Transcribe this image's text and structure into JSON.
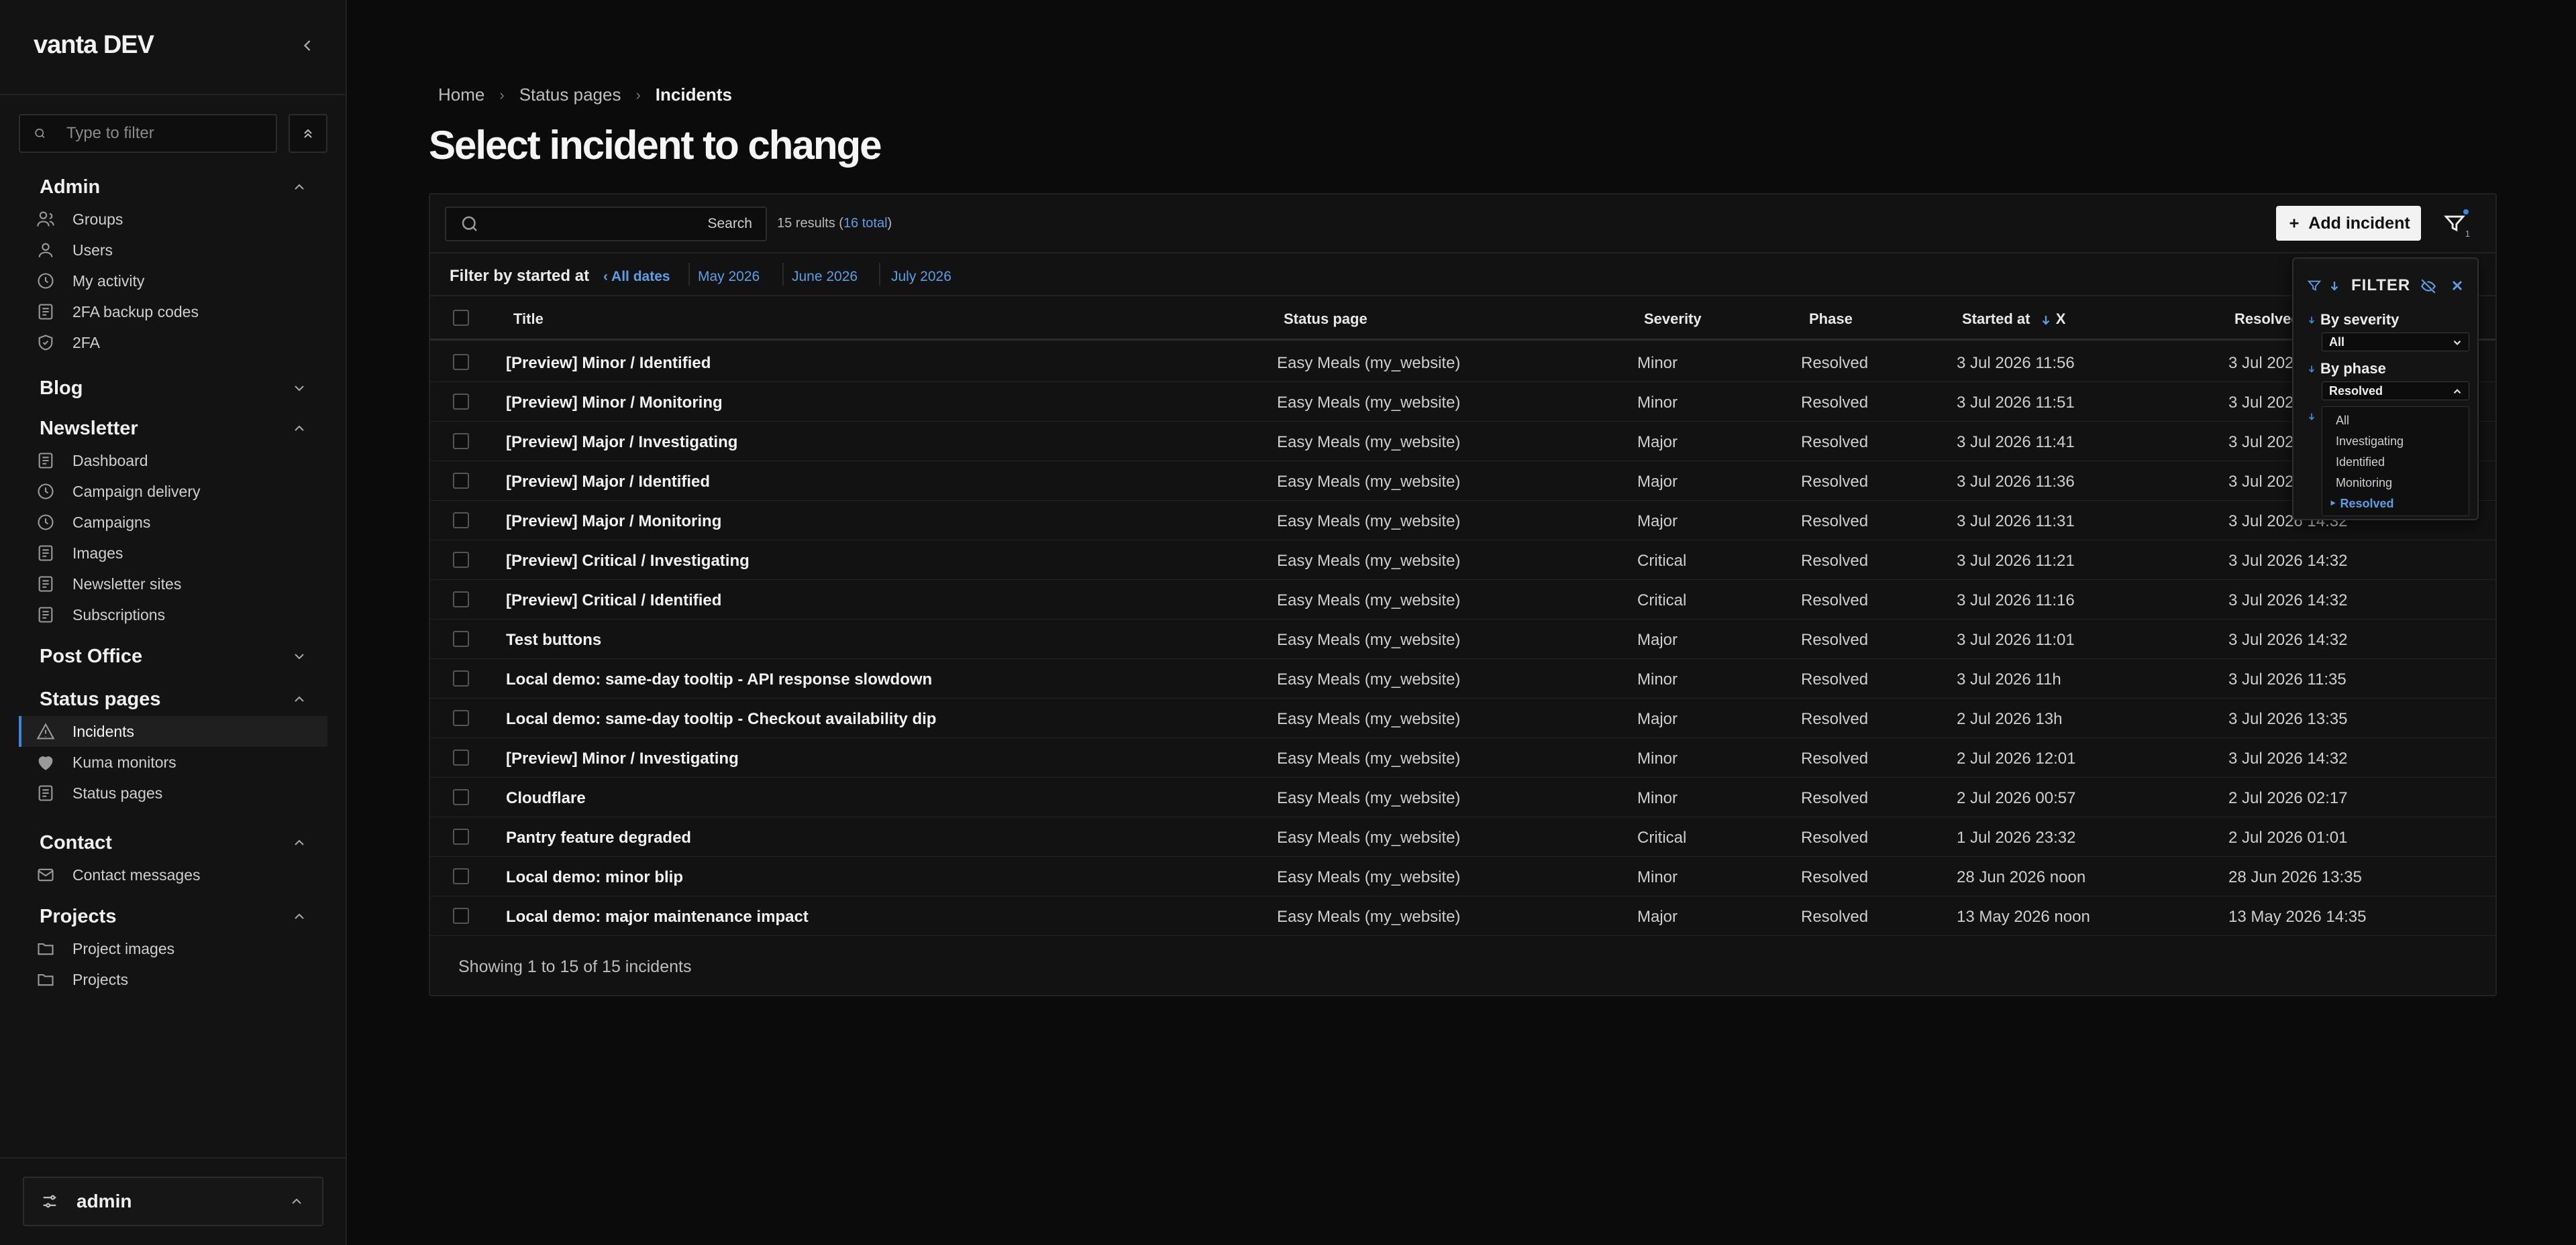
{
  "sidebar": {
    "brand": "vanta DEV",
    "filter_placeholder": "Type to filter",
    "groups": [
      {
        "title": "Admin",
        "items": [
          "Groups",
          "Users",
          "My activity",
          "2FA backup codes",
          "2FA"
        ]
      },
      {
        "title": "Blog",
        "items": []
      },
      {
        "title": "Newsletter",
        "items": [
          "Dashboard",
          "Campaign delivery",
          "Campaigns",
          "Images",
          "Newsletter sites",
          "Subscriptions"
        ]
      },
      {
        "title": "Post Office",
        "items": []
      },
      {
        "title": "Status pages",
        "items": [
          "Incidents",
          "Kuma monitors",
          "Status pages"
        ]
      },
      {
        "title": "Contact",
        "items": [
          "Contact messages"
        ]
      },
      {
        "title": "Projects",
        "items": [
          "Project images",
          "Projects"
        ]
      }
    ],
    "user": "admin"
  },
  "breadcrumb": {
    "home": "Home",
    "section": "Status pages",
    "current": "Incidents"
  },
  "page_title": "Select incident to change",
  "toolbar": {
    "search_button": "Search",
    "results_prefix": "15 results (",
    "results_total": "16 total",
    "results_suffix": ")",
    "add_button": "Add incident",
    "filter_count": "1"
  },
  "date_filter": {
    "label": "Filter by started at",
    "all": "‹ All dates",
    "links": [
      "May 2026",
      "June 2026",
      "July 2026"
    ]
  },
  "table": {
    "columns": {
      "title": "Title",
      "status_page": "Status page",
      "severity": "Severity",
      "phase": "Phase",
      "started_at": "Started at",
      "started_sort_clear": "X",
      "resolved_at": "Resolved at"
    },
    "rows": [
      {
        "title": "[Preview] Minor / Identified",
        "status_page": "Easy Meals (my_website)",
        "severity": "Minor",
        "phase": "Resolved",
        "started": "3 Jul 2026 11:56",
        "resolved": "3 Jul 2026 14:32"
      },
      {
        "title": "[Preview] Minor / Monitoring",
        "status_page": "Easy Meals (my_website)",
        "severity": "Minor",
        "phase": "Resolved",
        "started": "3 Jul 2026 11:51",
        "resolved": "3 Jul 2026 14:32"
      },
      {
        "title": "[Preview] Major / Investigating",
        "status_page": "Easy Meals (my_website)",
        "severity": "Major",
        "phase": "Resolved",
        "started": "3 Jul 2026 11:41",
        "resolved": "3 Jul 2026 14:32"
      },
      {
        "title": "[Preview] Major / Identified",
        "status_page": "Easy Meals (my_website)",
        "severity": "Major",
        "phase": "Resolved",
        "started": "3 Jul 2026 11:36",
        "resolved": "3 Jul 2026 14:32"
      },
      {
        "title": "[Preview] Major / Monitoring",
        "status_page": "Easy Meals (my_website)",
        "severity": "Major",
        "phase": "Resolved",
        "started": "3 Jul 2026 11:31",
        "resolved": "3 Jul 2026 14:32"
      },
      {
        "title": "[Preview] Critical / Investigating",
        "status_page": "Easy Meals (my_website)",
        "severity": "Critical",
        "phase": "Resolved",
        "started": "3 Jul 2026 11:21",
        "resolved": "3 Jul 2026 14:32"
      },
      {
        "title": "[Preview] Critical / Identified",
        "status_page": "Easy Meals (my_website)",
        "severity": "Critical",
        "phase": "Resolved",
        "started": "3 Jul 2026 11:16",
        "resolved": "3 Jul 2026 14:32"
      },
      {
        "title": "Test buttons",
        "status_page": "Easy Meals (my_website)",
        "severity": "Major",
        "phase": "Resolved",
        "started": "3 Jul 2026 11:01",
        "resolved": "3 Jul 2026 14:32"
      },
      {
        "title": "Local demo: same-day tooltip - API response slowdown",
        "status_page": "Easy Meals (my_website)",
        "severity": "Minor",
        "phase": "Resolved",
        "started": "3 Jul 2026 11h",
        "resolved": "3 Jul 2026 11:35"
      },
      {
        "title": "Local demo: same-day tooltip - Checkout availability dip",
        "status_page": "Easy Meals (my_website)",
        "severity": "Major",
        "phase": "Resolved",
        "started": "2 Jul 2026 13h",
        "resolved": "3 Jul 2026 13:35"
      },
      {
        "title": "[Preview] Minor / Investigating",
        "status_page": "Easy Meals (my_website)",
        "severity": "Minor",
        "phase": "Resolved",
        "started": "2 Jul 2026 12:01",
        "resolved": "3 Jul 2026 14:32"
      },
      {
        "title": "Cloudflare",
        "status_page": "Easy Meals (my_website)",
        "severity": "Minor",
        "phase": "Resolved",
        "started": "2 Jul 2026 00:57",
        "resolved": "2 Jul 2026 02:17"
      },
      {
        "title": "Pantry feature degraded",
        "status_page": "Easy Meals (my_website)",
        "severity": "Critical",
        "phase": "Resolved",
        "started": "1 Jul 2026 23:32",
        "resolved": "2 Jul 2026 01:01"
      },
      {
        "title": "Local demo: minor blip",
        "status_page": "Easy Meals (my_website)",
        "severity": "Minor",
        "phase": "Resolved",
        "started": "28 Jun 2026 noon",
        "resolved": "28 Jun 2026 13:35"
      },
      {
        "title": "Local demo: major maintenance impact",
        "status_page": "Easy Meals (my_website)",
        "severity": "Major",
        "phase": "Resolved",
        "started": "13 May 2026 noon",
        "resolved": "13 May 2026 14:35"
      }
    ],
    "footer": "Showing 1 to 15 of 15 incidents"
  },
  "filter_panel": {
    "title": "FILTER",
    "by_severity": "By severity",
    "severity_value": "All",
    "by_phase": "By phase",
    "phase_value": "Resolved",
    "phase_options": [
      "All",
      "Investigating",
      "Identified",
      "Monitoring",
      "Resolved"
    ],
    "selected_option_index": 4
  },
  "colors": {
    "accent": "#3a86d8",
    "link": "#5a9fe6",
    "background": "#0b0b0b",
    "sidebar": "#131313"
  }
}
